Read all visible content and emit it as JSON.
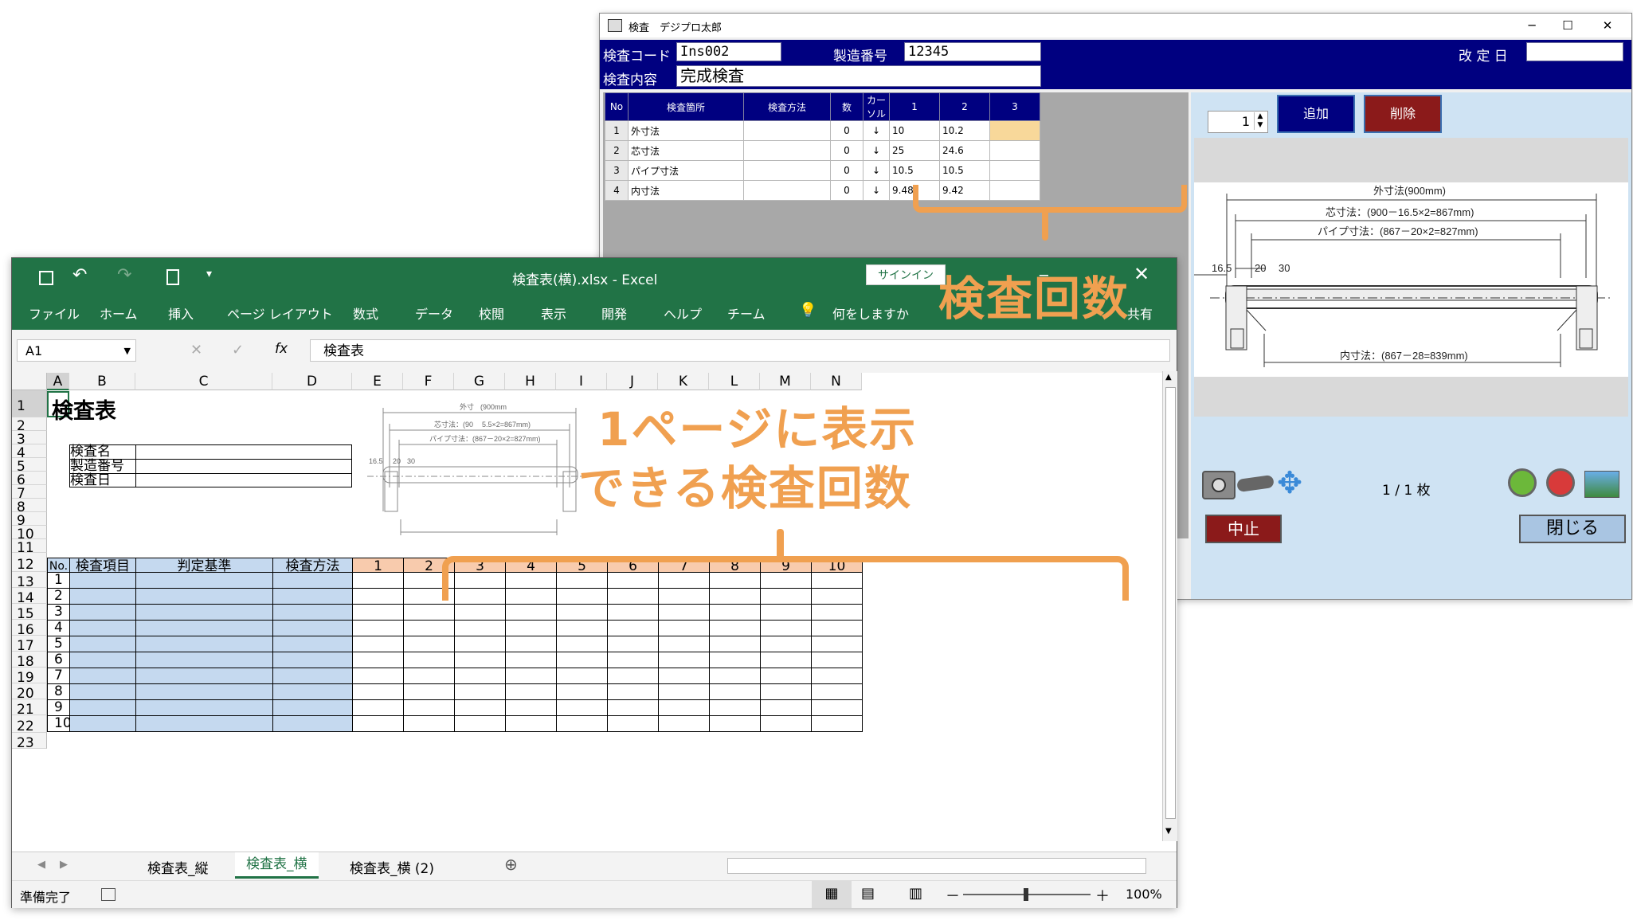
{
  "insp": {
    "title": "検査　デジプロ太郎",
    "win_buttons": [
      "─",
      "☐",
      "✕"
    ],
    "code_label": "検査コード",
    "code_value": "Ins002",
    "serial_label": "製造番号",
    "serial_value": "12345",
    "revdate_label": "改 定 日",
    "revdate_value": "",
    "content_label": "検査内容",
    "content_value": "完成検査",
    "grid_headers": [
      "No",
      "検査箇所",
      "検査方法",
      "数",
      "カーソル",
      "1",
      "2",
      "3"
    ],
    "grid_rows": [
      {
        "no": "1",
        "place": "外寸法",
        "method": "",
        "count": "0",
        "cursor": "↓",
        "v1": "10",
        "v2": "10.2",
        "v3": ""
      },
      {
        "no": "2",
        "place": "芯寸法",
        "method": "",
        "count": "0",
        "cursor": "↓",
        "v1": "25",
        "v2": "24.6",
        "v3": ""
      },
      {
        "no": "3",
        "place": "パイプ寸法",
        "method": "",
        "count": "0",
        "cursor": "↓",
        "v1": "10.5",
        "v2": "10.5",
        "v3": ""
      },
      {
        "no": "4",
        "place": "内寸法",
        "method": "",
        "count": "0",
        "cursor": "↓",
        "v1": "9.48",
        "v2": "9.42",
        "v3": ""
      }
    ],
    "spin_value": "1",
    "add_label": "追加",
    "delete_label": "削除",
    "drawing": {
      "outer": "外寸法(900mm)",
      "core": "芯寸法：(900－16.5×2=867mm)",
      "pipe": "パイプ寸法：(867－20×2=827mm)",
      "inner": "内寸法：(867－28=839mm)",
      "d1": "16.5",
      "d2": "20",
      "d3": "30"
    },
    "page_indicator": "1 /  1  枚",
    "stop_label": "中止",
    "close_label": "閉じる"
  },
  "excel": {
    "title": "検査表(横).xlsx  -  Excel",
    "signin": "サインイン",
    "share": "共有",
    "menus": [
      "ファイル",
      "ホーム",
      "挿入",
      "ページ レイアウト",
      "数式",
      "データ",
      "校閲",
      "表示",
      "開発",
      "ヘルプ",
      "チーム",
      "何をしますか"
    ],
    "namebox": "A1",
    "formula": "検査表",
    "columns": [
      "A",
      "B",
      "C",
      "D",
      "E",
      "F",
      "G",
      "H",
      "I",
      "J",
      "K",
      "L",
      "M",
      "N"
    ],
    "sheet_title": "検査表",
    "info_labels": [
      "検査名",
      "製造番号",
      "検査日"
    ],
    "table_headers": [
      "No.",
      "検査項目",
      "判定基準",
      "検査方法",
      "1",
      "2",
      "3",
      "4",
      "5",
      "6",
      "7",
      "8",
      "9",
      "10"
    ],
    "row_numbers": [
      "1",
      "2",
      "3",
      "4",
      "5",
      "6",
      "7",
      "8",
      "9",
      "10",
      "11",
      "12",
      "13",
      "14",
      "15",
      "16",
      "17",
      "18",
      "19",
      "20",
      "21",
      "22",
      "23"
    ],
    "item_numbers": [
      "1",
      "2",
      "3",
      "4",
      "5",
      "6",
      "7",
      "8",
      "9",
      "10"
    ],
    "mini_drawing": {
      "outer": "外寸",
      "outer2": "(900mm",
      "core": "芯寸法：(90",
      "core2": "5.5×2=867mm)",
      "pipe": "パイプ寸法：(867－20×2=827mm)",
      "d1": "16.5",
      "d2": "20",
      "d3": "30"
    },
    "sheet_tabs": [
      "検査表_縦",
      "検査表_横",
      "検査表_横 (2)"
    ],
    "status": "準備完了",
    "zoom": "100%"
  },
  "annotations": {
    "top": "検査回数",
    "middle_line1": "1ページに表示",
    "middle_line2": "できる検査回数"
  },
  "colors": {
    "accent_orange": "#f0a050",
    "excel_green": "#217346",
    "form_navy": "#000080",
    "header_blue": "#c5d9ef",
    "header_orange": "#f8cbad"
  }
}
